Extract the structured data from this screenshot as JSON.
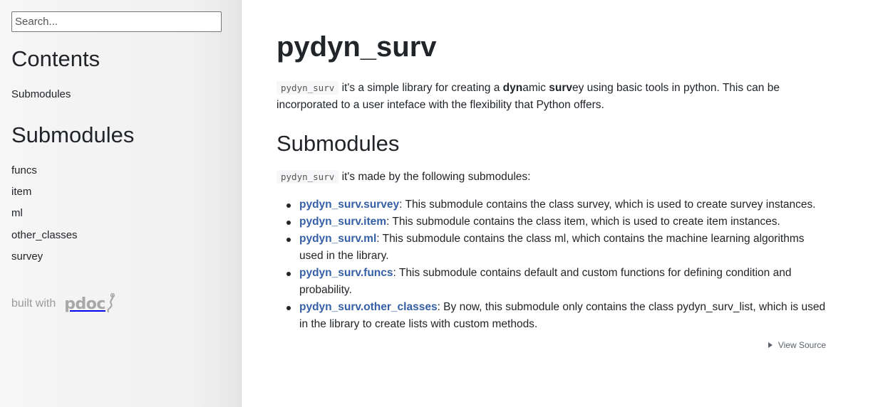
{
  "sidebar": {
    "search_placeholder": "Search...",
    "contents_heading": "Contents",
    "contents_items": [
      {
        "label": "Submodules"
      }
    ],
    "submodules_heading": "Submodules",
    "submodule_items": [
      {
        "label": "funcs"
      },
      {
        "label": "item"
      },
      {
        "label": "ml"
      },
      {
        "label": "other_classes"
      },
      {
        "label": "survey"
      }
    ],
    "built_with": "built with",
    "pdoc_logo_text": "pdoc"
  },
  "main": {
    "title": "pydyn_surv",
    "intro": {
      "code": "pydyn_surv",
      "text_1": " it's a simple library for creating a ",
      "bold_1": "dyn",
      "text_2": "amic ",
      "bold_2": "surv",
      "text_3": "ey using basic tools in python. This can be incorporated to a user inteface with the flexibility that Python offers."
    },
    "submodules_heading": "Submodules",
    "submodules_intro": {
      "code": "pydyn_surv",
      "text": " it's made by the following submodules:"
    },
    "submodules": [
      {
        "link": "pydyn_surv.survey",
        "desc": ": This submodule contains the class survey, which is used to create survey instances."
      },
      {
        "link": "pydyn_surv.item",
        "desc": ": This submodule contains the class item, which is used to create item instances."
      },
      {
        "link": "pydyn_surv.ml",
        "desc": ": This submodule contains the class ml, which contains the machine learning algorithms used in the library."
      },
      {
        "link": "pydyn_surv.funcs",
        "desc": ": This submodule contains default and custom functions for defining condition and probability."
      },
      {
        "link": "pydyn_surv.other_classes",
        "desc": ": By now, this submodule only contains the class pydyn_surv_list, which is used in the library to create lists with custom methods."
      }
    ],
    "view_source": "View Source"
  },
  "colors": {
    "link": "#3660a5",
    "sidebar_bg": "#f3f3f3",
    "text": "#212529"
  },
  "icons": {
    "pdoc_logo": "pdoc-logo-icon",
    "view_source_toggle": "triangle-right-icon"
  }
}
